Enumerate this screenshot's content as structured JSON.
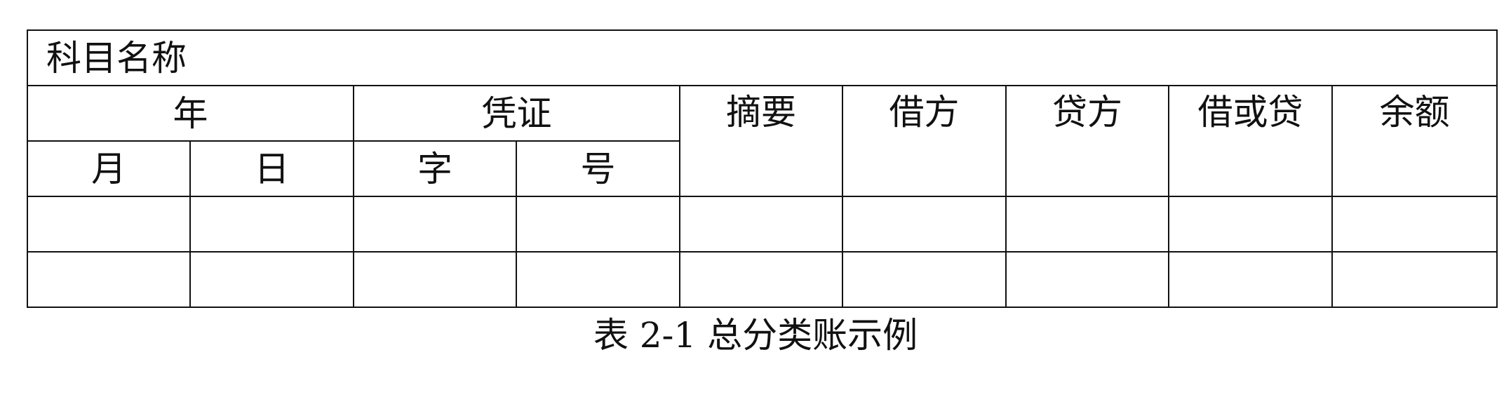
{
  "table": {
    "title": "科目名称",
    "headers": {
      "year": "年",
      "voucher": "凭证",
      "summary": "摘要",
      "debit": "借方",
      "credit": "贷方",
      "debit_or_credit": "借或贷",
      "balance": "余额",
      "month": "月",
      "day": "日",
      "voucher_type": "字",
      "voucher_number": "号"
    },
    "rows": [
      [
        "",
        "",
        "",
        "",
        "",
        "",
        "",
        "",
        ""
      ],
      [
        "",
        "",
        "",
        "",
        "",
        "",
        "",
        "",
        ""
      ]
    ]
  },
  "caption": "表 2-1 总分类账示例"
}
